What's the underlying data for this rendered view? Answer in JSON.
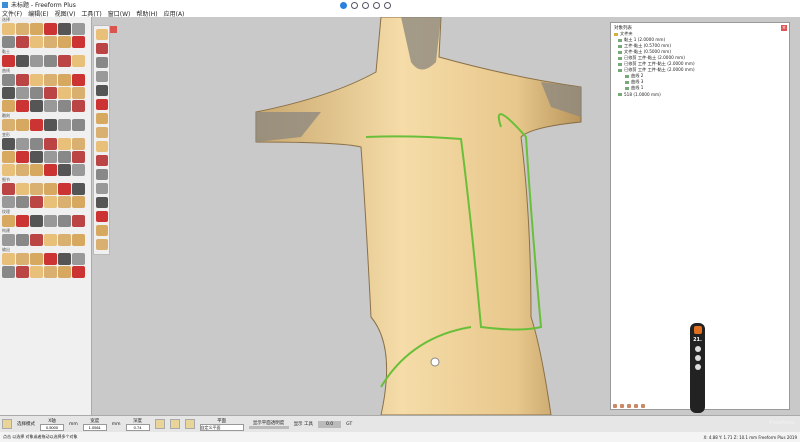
{
  "window": {
    "title": "未标题 - Freeform Plus"
  },
  "menu": [
    "文件(F)",
    "编辑(E)",
    "视图(V)",
    "工具(T)",
    "窗口(W)",
    "帮助(H)",
    "应用(A)"
  ],
  "palette": {
    "sections": [
      "选择",
      "黏土",
      "曲线",
      "雕刻",
      "变形",
      "细节",
      "纹理",
      "构建",
      "输出"
    ]
  },
  "tree": {
    "title": "对象列表",
    "close": "×",
    "items": [
      "文件夹",
      "黏土 1 (2.0000 mm)",
      "工件-黏土 (0.5700 mm)",
      "文件-黏土 (0.5000 mm)",
      "已修剪 工件-黏土 (2.0000 mm)",
      "已修剪 工件 工件-黏土 (2.0000 mm)",
      "已修剪 工件 工件-黏土 (2.0000 mm)",
      "曲线 2",
      "曲线 3",
      "曲线 1",
      "518 (1.0000 mm)"
    ]
  },
  "pill": {
    "value": "21."
  },
  "bottom": {
    "mode_label": "选择模式",
    "f1_label": "X轴",
    "f1_value": "0.5000",
    "unit1": "mm",
    "f2_label": "宽度",
    "f2_value": "1.0561",
    "unit2": "mm",
    "f3_label": "深度",
    "f3_value": "0.74",
    "select_label": "平面",
    "select_value": "自定义平面",
    "slider_label": "显示平面透明度",
    "check_label": "显示 工具",
    "btn_value": "0.0",
    "btn_label": "GT"
  },
  "status": {
    "left": "点击 以选择 对象或者拖动以选择多个对象",
    "right": "X: 4.88   Y: 1.71   Z: 10.1  mm    Freeform Plus 2019",
    "brand": "Freeform"
  }
}
